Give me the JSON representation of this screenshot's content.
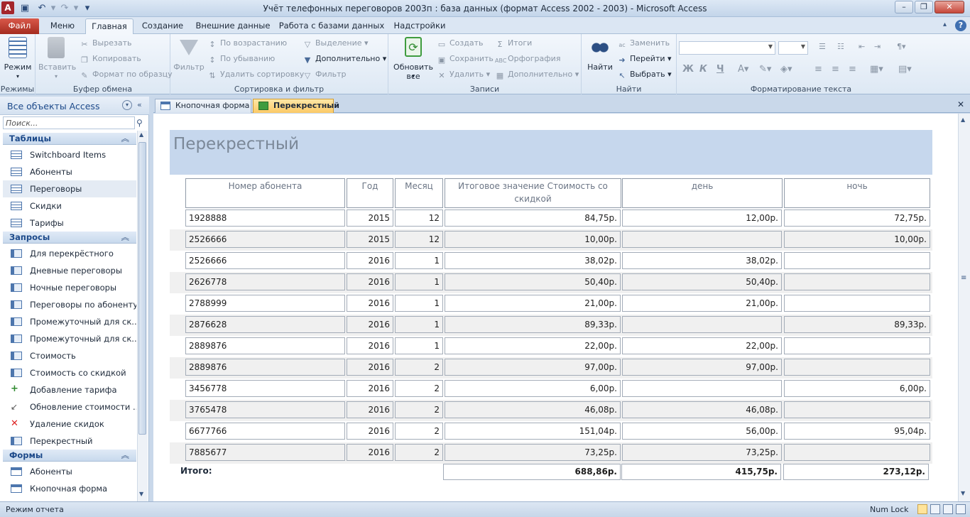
{
  "app": {
    "title": "Учёт телефонных переговоров 2003п : база данных (формат Access 2002 - 2003)  -  Microsoft Access",
    "icon_letter": "A"
  },
  "window_controls": {
    "minimize": "–",
    "maximize": "❐",
    "close": "✕"
  },
  "ribbon_tabs": [
    "Файл",
    "Меню",
    "Главная",
    "Создание",
    "Внешние данные",
    "Работа с базами данных",
    "Надстройки"
  ],
  "ribbon": {
    "views": {
      "btn": "Режим",
      "group": "Режимы"
    },
    "clipboard": {
      "paste": "Вставить",
      "cut": "Вырезать",
      "copy": "Копировать",
      "format_painter": "Формат по образцу",
      "group": "Буфер обмена"
    },
    "sort_filter": {
      "filter": "Фильтр",
      "asc": "По возрастанию",
      "desc": "По убыванию",
      "remove_sort": "Удалить сортировку",
      "selection": "Выделение",
      "advanced": "Дополнительно",
      "toggle_filter": "Фильтр",
      "group": "Сортировка и фильтр"
    },
    "records": {
      "refresh": "Обновить все",
      "new": "Создать",
      "save": "Сохранить",
      "delete": "Удалить",
      "totals": "Итоги",
      "spelling": "Орфография",
      "more": "Дополнительно",
      "group": "Записи"
    },
    "find": {
      "find": "Найти",
      "replace": "Заменить",
      "goto": "Перейти",
      "select": "Выбрать",
      "group": "Найти"
    },
    "text_format": {
      "bold": "Ж",
      "italic": "К",
      "underline": "Ч",
      "group": "Форматирование текста"
    }
  },
  "nav_pane": {
    "header": "Все объекты Access",
    "search_placeholder": "Поиск...",
    "sections": [
      {
        "title": "Таблицы",
        "items": [
          "Switchboard Items",
          "Абоненты",
          "Переговоры",
          "Скидки",
          "Тарифы"
        ]
      },
      {
        "title": "Запросы",
        "items": [
          "Для перекрёстного",
          "Дневные переговоры",
          "Ночные переговоры",
          "Переговоры по абоненту",
          "Промежуточный для ск...",
          "Промежуточный для ск...",
          "Стоимость",
          "Стоимость со скидкой",
          "Добавление тарифа",
          "Обновление стоимости ...",
          "Удаление скидок",
          "Перекрестный"
        ]
      },
      {
        "title": "Формы",
        "items": [
          "Абоненты",
          "Кнопочная форма"
        ]
      }
    ]
  },
  "doc_tabs": [
    "Кнопочная форма",
    "Перекрестный"
  ],
  "report": {
    "title": "Перекрестный",
    "headers": [
      "Номер абонента",
      "Год",
      "Месяц",
      "Итоговое значение Стоимость со скидкой",
      "день",
      "ночь"
    ],
    "rows": [
      [
        "1928888",
        "2015",
        "12",
        "84,75р.",
        "12,00р.",
        "72,75р."
      ],
      [
        "2526666",
        "2015",
        "12",
        "10,00р.",
        "",
        "10,00р."
      ],
      [
        "2526666",
        "2016",
        "1",
        "38,02р.",
        "38,02р.",
        ""
      ],
      [
        "2626778",
        "2016",
        "1",
        "50,40р.",
        "50,40р.",
        ""
      ],
      [
        "2788999",
        "2016",
        "1",
        "21,00р.",
        "21,00р.",
        ""
      ],
      [
        "2876628",
        "2016",
        "1",
        "89,33р.",
        "",
        "89,33р."
      ],
      [
        "2889876",
        "2016",
        "1",
        "22,00р.",
        "22,00р.",
        ""
      ],
      [
        "2889876",
        "2016",
        "2",
        "97,00р.",
        "97,00р.",
        ""
      ],
      [
        "3456778",
        "2016",
        "2",
        "6,00р.",
        "",
        "6,00р."
      ],
      [
        "3765478",
        "2016",
        "2",
        "46,08р.",
        "46,08р.",
        ""
      ],
      [
        "6677766",
        "2016",
        "2",
        "151,04р.",
        "56,00р.",
        "95,04р."
      ],
      [
        "7885677",
        "2016",
        "2",
        "73,25р.",
        "73,25р.",
        ""
      ]
    ],
    "totals": {
      "label": "Итого:",
      "total": "688,86р.",
      "day": "415,75р.",
      "night": "273,12р."
    }
  },
  "status": {
    "left": "Режим отчета",
    "numlock": "Num Lock"
  }
}
